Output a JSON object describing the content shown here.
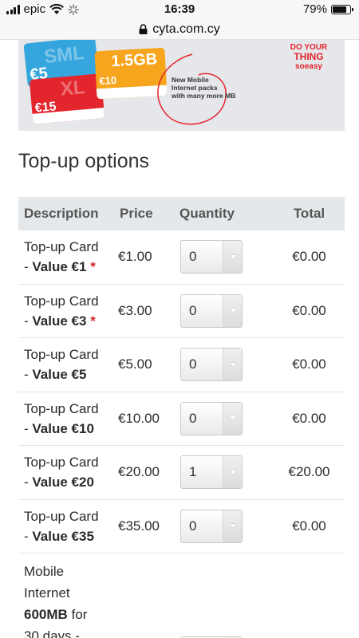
{
  "status_bar": {
    "carrier": "epic",
    "time": "16:39",
    "battery": "79%",
    "battery_level": 0.79
  },
  "url_bar": {
    "domain": "cyta.com.cy"
  },
  "banner": {
    "caption_line1": "New Mobile",
    "caption_line2": "Internet packs",
    "caption_line3": "with many more MB",
    "slogan_line1": "DO YOUR",
    "slogan_line2": "THING",
    "slogan_line3": "soeasy",
    "card_blue_price": "€5",
    "card_red_price": "€15",
    "card_orange_data": "1.5GB",
    "card_orange_price": "€10"
  },
  "page": {
    "heading": "Top-up options"
  },
  "table": {
    "headers": {
      "description": "Description",
      "price": "Price",
      "quantity": "Quantity",
      "total": "Total"
    },
    "rows": [
      {
        "line1": "Top-up Card",
        "dash": "- ",
        "bold": "Value €1",
        "required": "*",
        "price": "€1.00",
        "qty": "0",
        "total": "€0.00"
      },
      {
        "line1": "Top-up Card",
        "dash": "- ",
        "bold": "Value €3",
        "required": "*",
        "price": "€3.00",
        "qty": "0",
        "total": "€0.00"
      },
      {
        "line1": "Top-up Card",
        "dash": "- ",
        "bold": "Value €5",
        "required": "",
        "price": "€5.00",
        "qty": "0",
        "total": "€0.00"
      },
      {
        "line1": "Top-up Card",
        "dash": "- ",
        "bold": "Value €10",
        "required": "",
        "price": "€10.00",
        "qty": "0",
        "total": "€0.00"
      },
      {
        "line1": "Top-up Card",
        "dash": "- ",
        "bold": "Value €20",
        "required": "",
        "price": "€20.00",
        "qty": "1",
        "total": "€20.00"
      },
      {
        "line1": "Top-up Card",
        "dash": "- ",
        "bold": "Value €35",
        "required": "",
        "price": "€35.00",
        "qty": "0",
        "total": "€0.00"
      }
    ],
    "last_row": {
      "line1": "Mobile",
      "line2": "Internet",
      "bold": "600MB",
      "line3_rest": " for",
      "line4": "30 days -"
    }
  },
  "colors": {
    "accent_red": "#e3252d",
    "header_bg": "#e5e8ea"
  }
}
